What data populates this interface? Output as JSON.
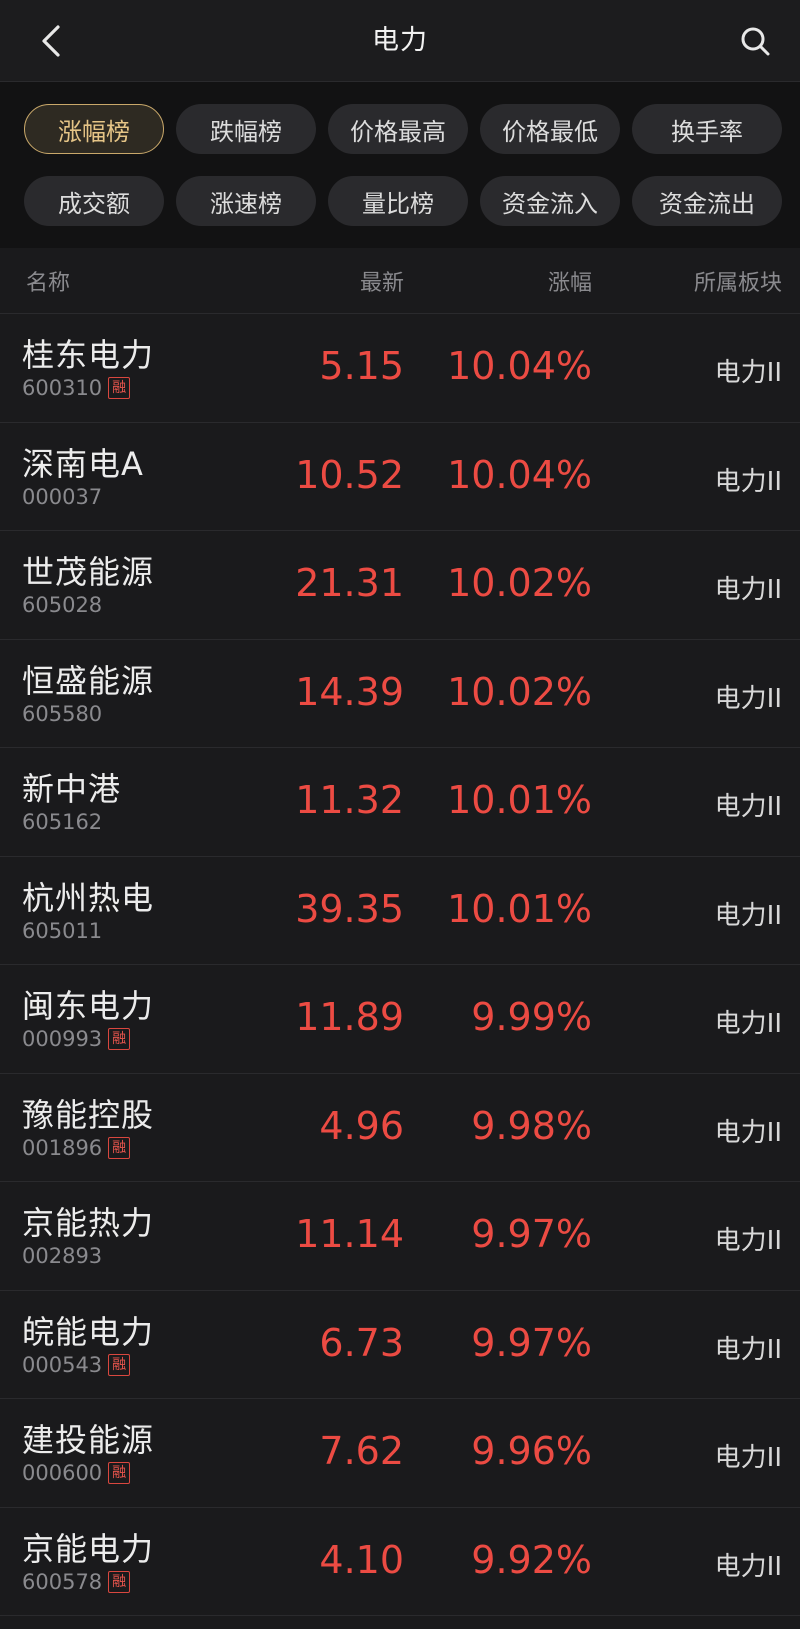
{
  "header": {
    "title": "电力"
  },
  "filters": {
    "row1": [
      "涨幅榜",
      "跌幅榜",
      "价格最高",
      "价格最低",
      "换手率"
    ],
    "row2": [
      "成交额",
      "涨速榜",
      "量比榜",
      "资金流入",
      "资金流出"
    ],
    "active": "涨幅榜"
  },
  "columns": {
    "name": "名称",
    "price": "最新",
    "change": "涨幅",
    "sector": "所属板块"
  },
  "rong_label": "融",
  "colors": {
    "background": "#1a1a1c",
    "filter_bg": "#121213",
    "up_red": "#ec4b43",
    "active_gold": "#c9a86a",
    "muted": "#8a8a8e"
  },
  "stocks": [
    {
      "name": "桂东电力",
      "code": "600310",
      "rong": true,
      "price": "5.15",
      "change": "10.04%",
      "sector": "电力II"
    },
    {
      "name": "深南电A",
      "code": "000037",
      "rong": false,
      "price": "10.52",
      "change": "10.04%",
      "sector": "电力II"
    },
    {
      "name": "世茂能源",
      "code": "605028",
      "rong": false,
      "price": "21.31",
      "change": "10.02%",
      "sector": "电力II"
    },
    {
      "name": "恒盛能源",
      "code": "605580",
      "rong": false,
      "price": "14.39",
      "change": "10.02%",
      "sector": "电力II"
    },
    {
      "name": "新中港",
      "code": "605162",
      "rong": false,
      "price": "11.32",
      "change": "10.01%",
      "sector": "电力II"
    },
    {
      "name": "杭州热电",
      "code": "605011",
      "rong": false,
      "price": "39.35",
      "change": "10.01%",
      "sector": "电力II"
    },
    {
      "name": "闽东电力",
      "code": "000993",
      "rong": true,
      "price": "11.89",
      "change": "9.99%",
      "sector": "电力II"
    },
    {
      "name": "豫能控股",
      "code": "001896",
      "rong": true,
      "price": "4.96",
      "change": "9.98%",
      "sector": "电力II"
    },
    {
      "name": "京能热力",
      "code": "002893",
      "rong": false,
      "price": "11.14",
      "change": "9.97%",
      "sector": "电力II"
    },
    {
      "name": "皖能电力",
      "code": "000543",
      "rong": true,
      "price": "6.73",
      "change": "9.97%",
      "sector": "电力II"
    },
    {
      "name": "建投能源",
      "code": "000600",
      "rong": true,
      "price": "7.62",
      "change": "9.96%",
      "sector": "电力II"
    },
    {
      "name": "京能电力",
      "code": "600578",
      "rong": true,
      "price": "4.10",
      "change": "9.92%",
      "sector": "电力II"
    }
  ]
}
